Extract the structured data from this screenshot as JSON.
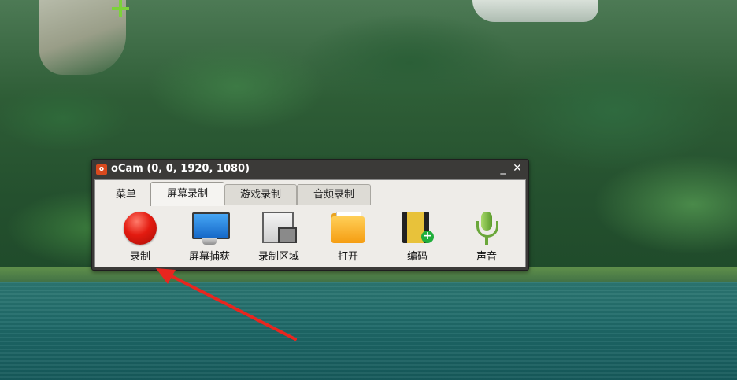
{
  "window": {
    "app_icon": "ocam-logo-icon",
    "title": "oCam (0, 0, 1920, 1080)",
    "minimize_label": "_",
    "close_label": "✕"
  },
  "tabs": [
    {
      "label": "菜单",
      "active": false
    },
    {
      "label": "屏幕录制",
      "active": true
    },
    {
      "label": "游戏录制",
      "active": false
    },
    {
      "label": "音频录制",
      "active": false
    }
  ],
  "toolbar": [
    {
      "label": "录制",
      "icon": "record-icon"
    },
    {
      "label": "屏幕捕获",
      "icon": "monitor-icon"
    },
    {
      "label": "录制区域",
      "icon": "record-area-icon"
    },
    {
      "label": "打开",
      "icon": "folder-icon"
    },
    {
      "label": "编码",
      "icon": "codec-film-icon"
    },
    {
      "label": "声音",
      "icon": "microphone-icon"
    }
  ],
  "colors": {
    "annotation_arrow": "#e8261f",
    "record_button": "#e31b10",
    "cursor_crosshair": "#7cd23a"
  }
}
